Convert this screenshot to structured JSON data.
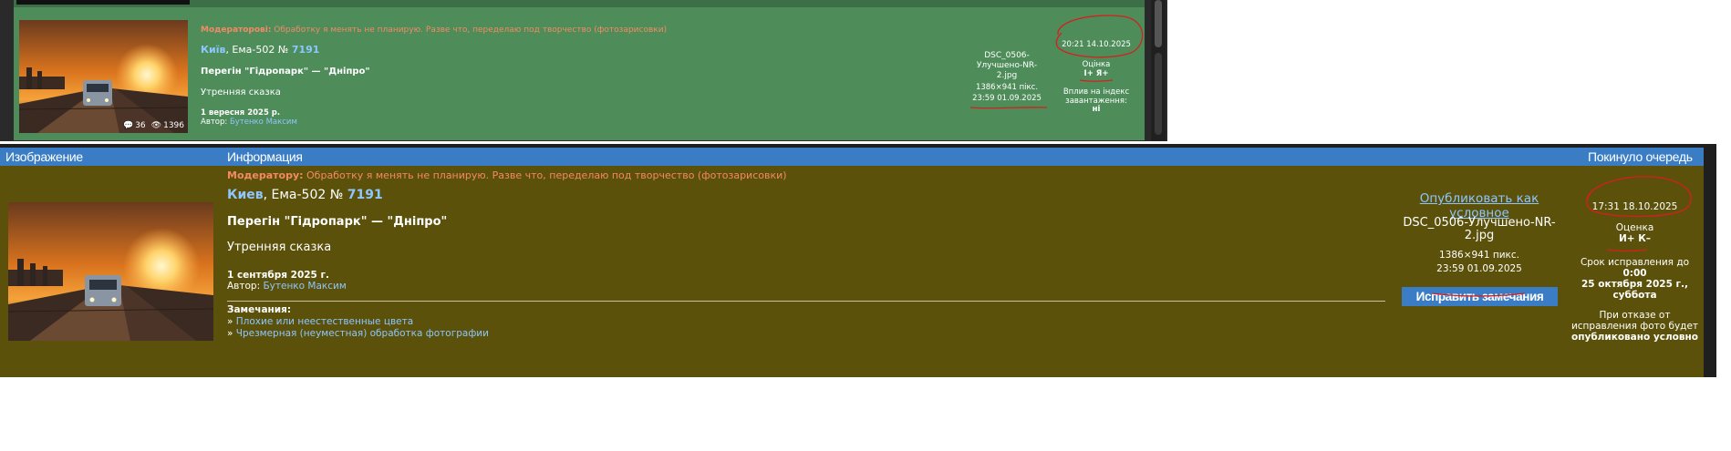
{
  "top_panel": {
    "moderator_label": "Модераторові:",
    "moderator_text": " Обработку я менять не планирую. Разве что, переделаю под творчество (фотозарисовки)",
    "city": "Київ",
    "vehicle": ", Ема-502 № ",
    "vehicle_number": "7191",
    "title": "Перегін \"Гідропарк\" — \"Дніпро\"",
    "description": "Утренняя сказка",
    "date": "1 вересня 2025 р.",
    "author_label": "Автор: ",
    "author": "Бутенко Максим",
    "comments": "36",
    "views": "1396",
    "file_name": "DSC_0506-Улучшено-NR-2.jpg",
    "file_size": "1386×941 пікс.",
    "file_date": "23:59 01.09.2025",
    "queue_time": "20:21 14.10.2025",
    "rating_label": "Оцінка",
    "rating_value": "І+ Я+",
    "index_label": "Вплив на індекс завантаження:",
    "index_value": "ні"
  },
  "bottom_panel": {
    "header": {
      "col_image": "Изображение",
      "col_info": "Информация",
      "col_left_queue": "Покинуло очередь"
    },
    "moderator_label": "Модератору:",
    "moderator_text": " Обработку я менять не планирую. Разве что, переделаю под творчество (фотозарисовки)",
    "city": "Киев",
    "vehicle": ", Ема-502 № ",
    "vehicle_number": "7191",
    "title": "Перегін \"Гідропарк\" — \"Дніпро\"",
    "description": "Утренняя сказка",
    "date": "1 сентября 2025 г.",
    "author_label": "Автор: ",
    "author": "Бутенко Максим",
    "notes_label": "Замечания:",
    "notes": [
      "Плохие или неестественные цвета",
      "Чрезмерная (неуместная) обработка фотографии"
    ],
    "publish_link": "Опубликовать как условное",
    "file_name": "DSC_0506-Улучшено-NR-2.jpg",
    "file_size": "1386×941 пикс.",
    "file_date": "23:59 01.09.2025",
    "fix_button": "Исправить замечания",
    "queue_time": "17:31 18.10.2025",
    "rating_label": "Оценка",
    "rating_value": "И+ К–",
    "deadline_label": "Срок исправления до",
    "deadline_time": "0:00",
    "deadline_date": "25 октября 2025 г.,",
    "deadline_day": "суббота",
    "refuse_text": "При отказе от исправления фото будет",
    "refuse_result": "опубликовано условно"
  },
  "colors": {
    "top_bg": "#4e8d5a",
    "bottom_bg": "#5b510a",
    "header_bg": "#3b7dc4",
    "link": "#8ec6ff",
    "moderator": "#f28a64",
    "annotation": "#d42020"
  }
}
